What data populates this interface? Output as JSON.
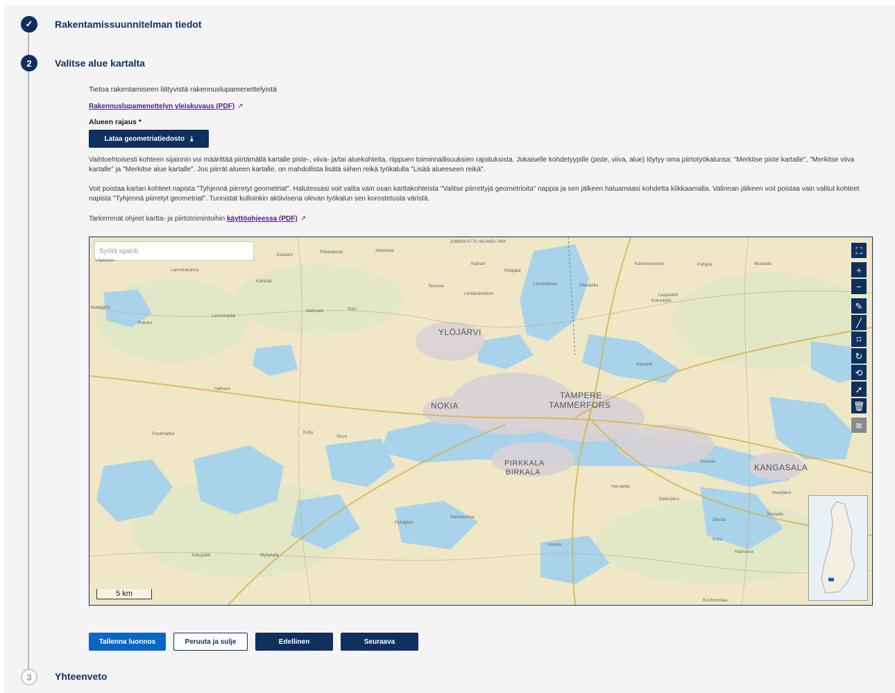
{
  "steps": [
    {
      "status": "done",
      "icon": "check-icon",
      "title": "Rakentamissuunnitelman tiedot"
    },
    {
      "status": "active",
      "number": "2",
      "title": "Valitse alue kartalta"
    },
    {
      "status": "pending",
      "number": "3",
      "title": "Yhteenveto"
    }
  ],
  "info": {
    "intro": "Tietoa rakentamiseen liittyvistä rakennuslupamenettelyistä",
    "overview_link": "Rakennuslupamenettelyn yleiskuvaus (PDF)",
    "area_label": "Alueen rajaus *",
    "upload_button": "Lataa geometriatiedosto",
    "para1": "Vaihtoehtoisesti kohteen sijainnin voi määrittää piirtämällä kartalle piste-, viiva- ja/tai aluekohteita, riippuen toiminnallisuuksien rajoituksista. Jokaiselle kohdetyypille (piste, viiva, alue) löytyy oma piirtotyökalunsa: \"Merkitse piste kartalle\", \"Merkitse viiva kartalle\" ja \"Merkitse alue kartalle\". Jos piirrät alueen kartalle, on mahdollista lisätä siihen reikä työkalulla \"Lisää alueeseen reikä\".",
    "para2": "Voit poistaa kartan kohteet napista \"Tyhjennä piirretyt geometriat\". Halutessasi voit valita vain osan karttakohteista \"Valitse piirrettyjä geometrioita\" nappia ja sen jälkeen haluamaasi kohdetta klikkaamalla. Valinnan jälkeen voit poistaa vain valitut kohteet napista \"Tyhjennä piirretyt geometriat\". Tunnistat kulloinkin aktiivisena olevan työkalun sen korostetusta väristä.",
    "para3_prefix": "Tarkemmat ohjeet kartta- ja piirtotoimintoihin",
    "para3_link": "käyttöohjeessa (PDF)"
  },
  "map": {
    "search_placeholder": "Syötä sijainti",
    "coordinates": "3288300 6770, 6814450 7884",
    "scale": "5 km",
    "labels": [
      {
        "name": "YLÖJÄRVI"
      },
      {
        "name": "NOKIA"
      },
      {
        "name": "TAMPERE"
      },
      {
        "name": "TAMMERFORS"
      },
      {
        "name": "PIRKKALA"
      },
      {
        "name": "BIRKALA"
      },
      {
        "name": "KANGASALA"
      }
    ],
    "small_labels": [
      "Kaislani",
      "Rokkakoski",
      "Akkoinaa",
      "Kaihari",
      "Petäjälä",
      "Lempäänen",
      "Pikkavilla",
      "Pohjola",
      "Kämmenniemi",
      "Lamminkulma",
      "Karttula",
      "Muotiala",
      "Kolunkylä",
      "Tesoma",
      "Lentävänniemi",
      "Hervanta",
      "Vuores",
      "Suinula",
      "Sääksjärvi",
      "Kuru",
      "Aitolahti",
      "Lamminpää",
      "Mahnala",
      "Sasi",
      "Pukara",
      "Puolimatka",
      "Kulju",
      "Siuro",
      "Viljakkala",
      "Myllykylä",
      "Kärppälä",
      "Haihara",
      "Pyhäjärvi",
      "Kortejärvi",
      "Leppilahti",
      "Otsola",
      "Sarankulma",
      "Haviseva",
      "Teivaala",
      "Huutijärvi",
      "Kuohenmaa"
    ],
    "tools": [
      {
        "name": "fullscreen-icon",
        "glyph": "⛶"
      },
      {
        "name": "zoom-in-icon",
        "glyph": "+"
      },
      {
        "name": "zoom-out-icon",
        "glyph": "−"
      },
      {
        "name": "draw-point-icon",
        "glyph": "✎"
      },
      {
        "name": "draw-line-icon",
        "glyph": "╱"
      },
      {
        "name": "draw-area-icon",
        "glyph": "⌑"
      },
      {
        "name": "add-hole-icon",
        "glyph": "↻"
      },
      {
        "name": "undo-icon",
        "glyph": "⟲"
      },
      {
        "name": "select-geometries-icon",
        "glyph": "➚"
      },
      {
        "name": "delete-geometries-icon",
        "glyph": "🗑"
      },
      {
        "name": "layers-icon",
        "glyph": "≋"
      }
    ]
  },
  "actions": {
    "save_draft": "Tallenna luonnos",
    "cancel": "Peruuta ja sulje",
    "previous": "Edellinen",
    "next": "Seuraava"
  },
  "colors": {
    "navy": "#0f2f5d",
    "primary_blue": "#0a66c2",
    "link_purple": "#4b1d86",
    "water": "#a8d3ea",
    "land": "#efe7c6",
    "urban": "#d9d2d6"
  }
}
